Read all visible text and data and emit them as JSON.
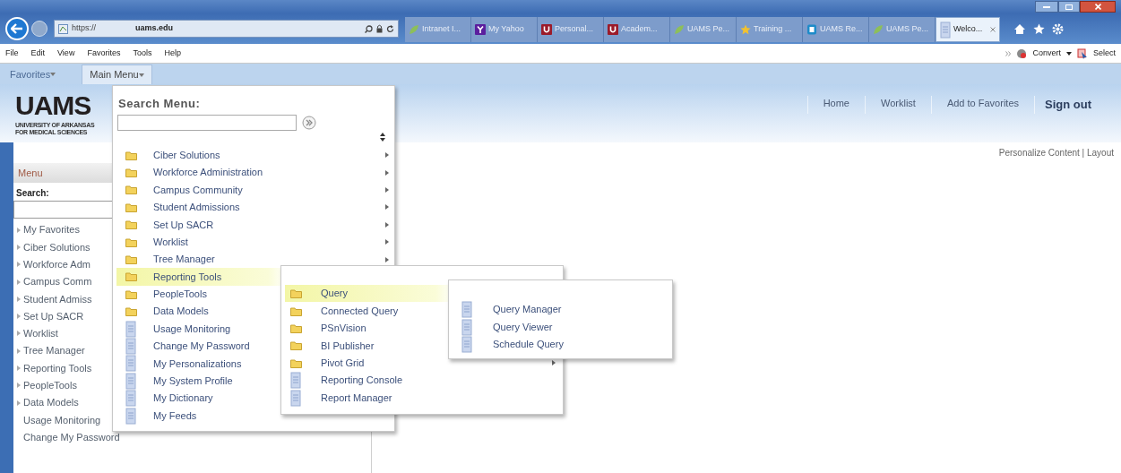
{
  "browser": {
    "url_parts": [
      "https://",
      "uams.edu"
    ],
    "tabs": [
      {
        "label": "Intranet I...",
        "kind": "leaf",
        "selected": false
      },
      {
        "label": "My Yahoo",
        "kind": "yahoo",
        "selected": false
      },
      {
        "label": "Personal...",
        "kind": "u",
        "selected": false
      },
      {
        "label": "Academ...",
        "kind": "u",
        "selected": false
      },
      {
        "label": "UAMS Pe...",
        "kind": "leaf",
        "selected": false
      },
      {
        "label": "Training ...",
        "kind": "star",
        "selected": false
      },
      {
        "label": "UAMS Re...",
        "kind": "doc",
        "selected": false
      },
      {
        "label": "UAMS Pe...",
        "kind": "leaf",
        "selected": false
      },
      {
        "label": "Welco...",
        "kind": "page",
        "selected": true
      }
    ],
    "menu_bar": [
      "File",
      "Edit",
      "View",
      "Favorites",
      "Tools",
      "Help"
    ],
    "command_bar": {
      "convert": "Convert",
      "select": "Select"
    }
  },
  "nav_bar": [
    {
      "label": "Favorites",
      "selected": false
    },
    {
      "label": "Main Menu",
      "selected": true
    }
  ],
  "header": {
    "logo": "UAMS",
    "logo_subtitle": [
      "UNIVERSITY OF ARKANSAS",
      "FOR MEDICAL SCIENCES"
    ],
    "links": [
      {
        "label": "Home",
        "bold": false
      },
      {
        "label": "Worklist",
        "bold": false
      },
      {
        "label": "Add to Favorites",
        "bold": false
      },
      {
        "label": "Sign out",
        "bold": true
      }
    ]
  },
  "personalize": "Personalize Content | Layout",
  "sidebar": {
    "title": "Menu",
    "search_label": "Search:",
    "items": [
      {
        "label": "My Favorites",
        "has_arrow": true
      },
      {
        "label": "Ciber Solutions",
        "has_arrow": true
      },
      {
        "label": "Workforce Adm",
        "has_arrow": true
      },
      {
        "label": "Campus Comm",
        "has_arrow": true
      },
      {
        "label": "Student Admiss",
        "has_arrow": true
      },
      {
        "label": "Set Up SACR",
        "has_arrow": true
      },
      {
        "label": "Worklist",
        "has_arrow": true
      },
      {
        "label": "Tree Manager",
        "has_arrow": true
      },
      {
        "label": "Reporting Tools",
        "has_arrow": true
      },
      {
        "label": "PeopleTools",
        "has_arrow": true
      },
      {
        "label": "Data Models",
        "has_arrow": true
      },
      {
        "label": "Usage Monitoring",
        "has_arrow": false
      },
      {
        "label": "Change My Password",
        "has_arrow": false
      }
    ]
  },
  "main_menu": {
    "search_label": "Search Menu:",
    "items": [
      {
        "label": "Ciber Solutions",
        "kind": "folder",
        "has_submenu": true,
        "selected": false
      },
      {
        "label": "Workforce Administration",
        "kind": "folder",
        "has_submenu": true,
        "selected": false
      },
      {
        "label": "Campus Community",
        "kind": "folder",
        "has_submenu": true,
        "selected": false
      },
      {
        "label": "Student Admissions",
        "kind": "folder",
        "has_submenu": true,
        "selected": false
      },
      {
        "label": "Set Up SACR",
        "kind": "folder",
        "has_submenu": true,
        "selected": false
      },
      {
        "label": "Worklist",
        "kind": "folder",
        "has_submenu": true,
        "selected": false
      },
      {
        "label": "Tree Manager",
        "kind": "folder",
        "has_submenu": true,
        "selected": false
      },
      {
        "label": "Reporting Tools",
        "kind": "folder",
        "selected": true
      },
      {
        "label": "PeopleTools",
        "kind": "folder",
        "selected": false
      },
      {
        "label": "Data Models",
        "kind": "folder",
        "selected": false
      },
      {
        "label": "Usage Monitoring",
        "kind": "page",
        "selected": false
      },
      {
        "label": "Change My Password",
        "kind": "page",
        "selected": false
      },
      {
        "label": "My Personalizations",
        "kind": "page",
        "selected": false
      },
      {
        "label": "My System Profile",
        "kind": "page",
        "selected": false
      },
      {
        "label": "My Dictionary",
        "kind": "page",
        "selected": false
      },
      {
        "label": "My Feeds",
        "kind": "page",
        "has_submenu": false,
        "selected": false
      }
    ]
  },
  "reporting_tools_menu": {
    "items": [
      {
        "label": "Query",
        "kind": "folder",
        "selected": true
      },
      {
        "label": "Connected Query",
        "kind": "folder",
        "selected": false
      },
      {
        "label": "PSnVision",
        "kind": "folder",
        "selected": false
      },
      {
        "label": "BI Publisher",
        "kind": "folder",
        "selected": false
      },
      {
        "label": "Pivot Grid",
        "kind": "folder",
        "has_submenu": true,
        "selected": false
      },
      {
        "label": "Reporting Console",
        "kind": "page",
        "has_submenu": false,
        "selected": false
      },
      {
        "label": "Report Manager",
        "kind": "page",
        "has_submenu": false,
        "selected": false
      }
    ]
  },
  "query_menu": {
    "items": [
      {
        "label": "Query Manager",
        "kind": "page",
        "has_submenu": false,
        "selected": false
      },
      {
        "label": "Query Viewer",
        "kind": "page",
        "has_submenu": false,
        "selected": false
      },
      {
        "label": "Schedule Query",
        "kind": "page",
        "has_submenu": false,
        "selected": false
      }
    ]
  }
}
